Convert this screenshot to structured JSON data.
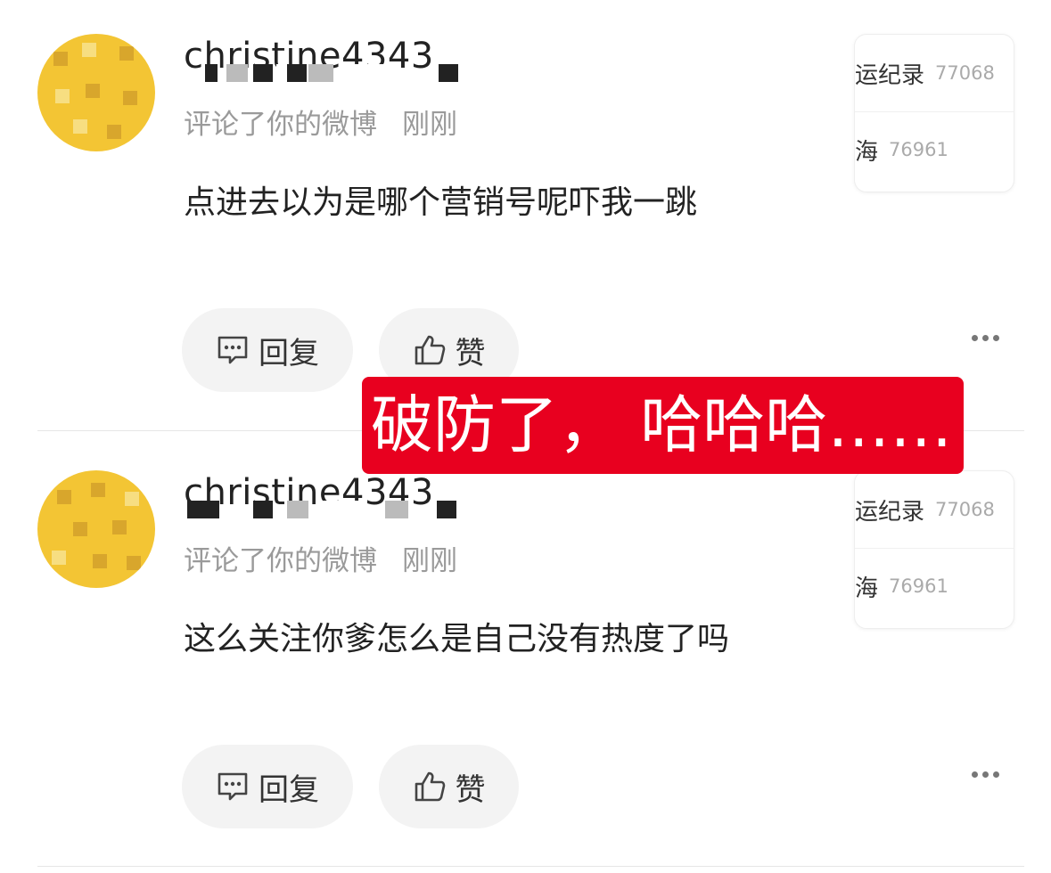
{
  "notifications": [
    {
      "username": "christine4343",
      "action": "评论了你的微博",
      "time": "刚刚",
      "text": "点进去以为是哪个营销号呢吓我一跳",
      "reply_label": "回复",
      "like_label": "赞",
      "card": [
        {
          "title": "运纪录",
          "count": "77068"
        },
        {
          "title": "海",
          "count": "76961"
        }
      ]
    },
    {
      "username": "christine4343",
      "action": "评论了你的微博",
      "time": "刚刚",
      "text": "这么关注你爹怎么是自己没有热度了吗",
      "reply_label": "回复",
      "like_label": "赞",
      "card": [
        {
          "title": "运纪录",
          "count": "77068"
        },
        {
          "title": "海",
          "count": "76961"
        }
      ]
    }
  ],
  "overlay_caption": "破防了，  哈哈哈……",
  "icons": {
    "reply": "comment-bubble-icon",
    "like": "thumbs-up-icon",
    "more": "more-dots-icon"
  },
  "colors": {
    "banner": "#e8001f",
    "avatar": "#f3c534",
    "meta_text": "#9a9a9a",
    "pill_bg": "#f3f3f3"
  }
}
